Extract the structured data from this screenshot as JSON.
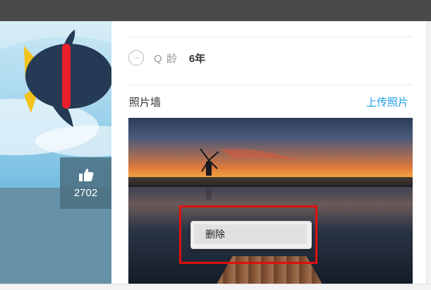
{
  "profile": {
    "likes": "2702",
    "q_age_label": "Q 龄",
    "q_age_value": "6年"
  },
  "photo_wall": {
    "title": "照片墙",
    "upload_label": "上传照片"
  },
  "context_menu": {
    "items": [
      {
        "label": "删除"
      }
    ]
  },
  "colors": {
    "accent_link": "#1d9ee8",
    "highlight": "#e01010",
    "topbar": "#4a4a4a"
  },
  "icons": [
    "thumbs-up-icon",
    "more-dots-icon"
  ]
}
